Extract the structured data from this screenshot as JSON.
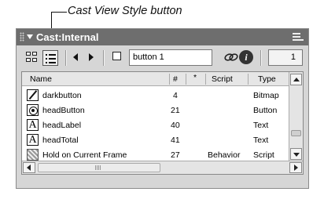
{
  "callout": {
    "label": "Cast View Style button"
  },
  "window": {
    "title": "Cast:Internal"
  },
  "toolbar": {
    "member_name": "button 1",
    "member_number": "1"
  },
  "columns": {
    "name": "Name",
    "number": "#",
    "modified": "*",
    "script": "Script",
    "type": "Type"
  },
  "rows": [
    {
      "icon": "bitmap-icon",
      "name": "darkbutton",
      "number": "4",
      "script": "",
      "type": "Bitmap"
    },
    {
      "icon": "button-icon",
      "name": "headButton",
      "number": "21",
      "script": "",
      "type": "Button"
    },
    {
      "icon": "text-icon",
      "name": "headLabel",
      "number": "40",
      "script": "",
      "type": "Text"
    },
    {
      "icon": "text-icon",
      "name": "headTotal",
      "number": "41",
      "script": "",
      "type": "Text"
    },
    {
      "icon": "behavior-icon",
      "name": "Hold on Current Frame",
      "number": "27",
      "script": "Behavior",
      "type": "Script"
    }
  ]
}
